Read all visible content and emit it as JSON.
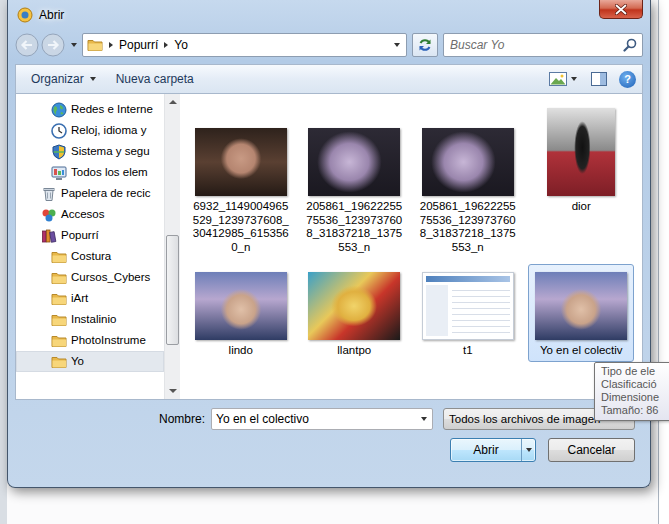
{
  "window": {
    "title": "Abrir"
  },
  "navigation": {
    "back": {
      "disabled": true
    },
    "forward": {
      "disabled": true
    },
    "path": [
      "Popurrí",
      "Yo"
    ],
    "search": {
      "placeholder": "Buscar Yo"
    }
  },
  "toolbar": {
    "items": [
      {
        "label": "Organizar",
        "menu": true
      },
      {
        "label": "Nueva carpeta",
        "menu": false
      }
    ],
    "help": "?"
  },
  "sidebar": {
    "items": [
      {
        "label": "Redes e Interne",
        "kind": "network",
        "selected": false
      },
      {
        "label": "Reloj, idioma y",
        "kind": "clock",
        "selected": false
      },
      {
        "label": "Sistema y segu",
        "kind": "security",
        "selected": false
      },
      {
        "label": "Todos los elem",
        "kind": "controlpanel",
        "selected": false
      },
      {
        "label": "Papelera de recic",
        "kind": "bin",
        "selected": false
      },
      {
        "label": "Accesos",
        "kind": "shortcut",
        "selected": false
      },
      {
        "label": "Popurrí",
        "kind": "library",
        "selected": false
      },
      {
        "label": "Costura",
        "kind": "folder",
        "selected": false
      },
      {
        "label": "Cursos_Cybers",
        "kind": "folder",
        "selected": false
      },
      {
        "label": "iArt",
        "kind": "folder",
        "selected": false
      },
      {
        "label": "Instalinio",
        "kind": "folder",
        "selected": false
      },
      {
        "label": "PhotoInstrume",
        "kind": "folder",
        "selected": false
      },
      {
        "label": "Yo",
        "kind": "folder",
        "selected": true
      }
    ]
  },
  "files": [
    {
      "name": "6932_1149004965529_1239737608_30412985_6153560_n",
      "kind": "landscape",
      "selected": false
    },
    {
      "name": "205861_1962225575536_1239737608_31837218_1375553_n",
      "kind": "landscape",
      "selected": false
    },
    {
      "name": "205861_1962225575536_1239737608_31837218_1375553_n",
      "kind": "landscape",
      "selected": false
    },
    {
      "name": "dior",
      "kind": "portrait",
      "selected": false
    },
    {
      "name": "lindo",
      "kind": "landscape",
      "selected": false
    },
    {
      "name": "llantpo",
      "kind": "landscape",
      "selected": false
    },
    {
      "name": "t1",
      "kind": "screenshot",
      "selected": false
    },
    {
      "name": "Yo en el colectiv",
      "kind": "landscape",
      "selected": true
    }
  ],
  "tooltip": {
    "lines": [
      "Tipo de ele",
      "Clasificació",
      "Dimensione",
      "Tamaño: 86"
    ]
  },
  "filename": {
    "label": "Nombre:",
    "value": "Yo en el colectivo"
  },
  "filter": {
    "value": "Todos los archivos de imagen"
  },
  "buttons": [
    {
      "label": "Abrir",
      "default": true,
      "split": true
    },
    {
      "label": "Cancelar",
      "default": false,
      "split": false
    }
  ]
}
